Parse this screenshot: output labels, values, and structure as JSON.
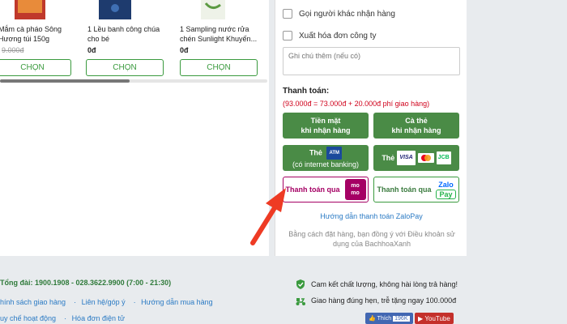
{
  "products": [
    {
      "name": "Mắm cà pháo Sông Hương túi 150g",
      "name_prefix_hidden": true,
      "price": "",
      "old_price": "9.000đ",
      "button": "CHỌN"
    },
    {
      "name": "1 Lều banh công chúa cho bé",
      "price": "0đ",
      "old_price": "",
      "button": "CHỌN"
    },
    {
      "name": "1 Sampling nước rửa chén Sunlight Khuyến...",
      "price": "0đ",
      "old_price": "",
      "button": "CHỌN"
    }
  ],
  "options": {
    "other_receiver": "Gọi người khác nhận hàng",
    "company_invoice": "Xuất hóa đơn công ty",
    "note_placeholder": "Ghi chú thêm (nếu có)"
  },
  "payment": {
    "title": "Thanh toán:",
    "formula": "(93.000đ = 73.000đ + 20.000đ phí giao hàng)",
    "cash_line1": "Tiền mặt",
    "cash_line2": "khi nhận hàng",
    "card_line1": "Cà thẻ",
    "card_line2": "khi nhận hàng",
    "atm_label": "Thẻ",
    "atm_badge": "ATM",
    "atm_sub": "(có internet banking)",
    "intl_label": "Thẻ",
    "visa": "VISA",
    "master": "MASTER",
    "jcb": "JCB",
    "momo_label": "Thanh toán qua",
    "momo_line1": "mo",
    "momo_line2": "mo",
    "zalo_label": "Thanh toán qua",
    "zalo_top": "Zalo",
    "zalo_bottom": "Pay",
    "zalopay_guide": "Hướng dẫn thanh toán ZaloPay",
    "terms": "Bằng cách đặt hàng, bạn đồng ý với Điều khoản sử dụng của BachhoaXanh"
  },
  "footer": {
    "hotline": "Tổng đài: 1900.1908 - 028.3622.9900 (7:00 - 21:30)",
    "links_row1": [
      "hính sách giao hàng",
      "Liên hệ/góp ý",
      "Hướng dẫn mua hàng"
    ],
    "links_row2": [
      "uy chế hoạt động",
      "Hóa đơn điện tử"
    ],
    "promise1": "Cam kết chất lượng, không hài lòng trả hàng!",
    "promise2": "Giao hàng đúng hẹn, trễ tặng ngay 100.000đ",
    "fb_like": "Thích",
    "fb_count": "196K",
    "youtube": "YouTube"
  },
  "colors": {
    "brand_green": "#4a8b46",
    "momo": "#a50064",
    "zalopay": "#0068ff",
    "price_red": "#d0021b",
    "arrow": "#ee3b24"
  }
}
